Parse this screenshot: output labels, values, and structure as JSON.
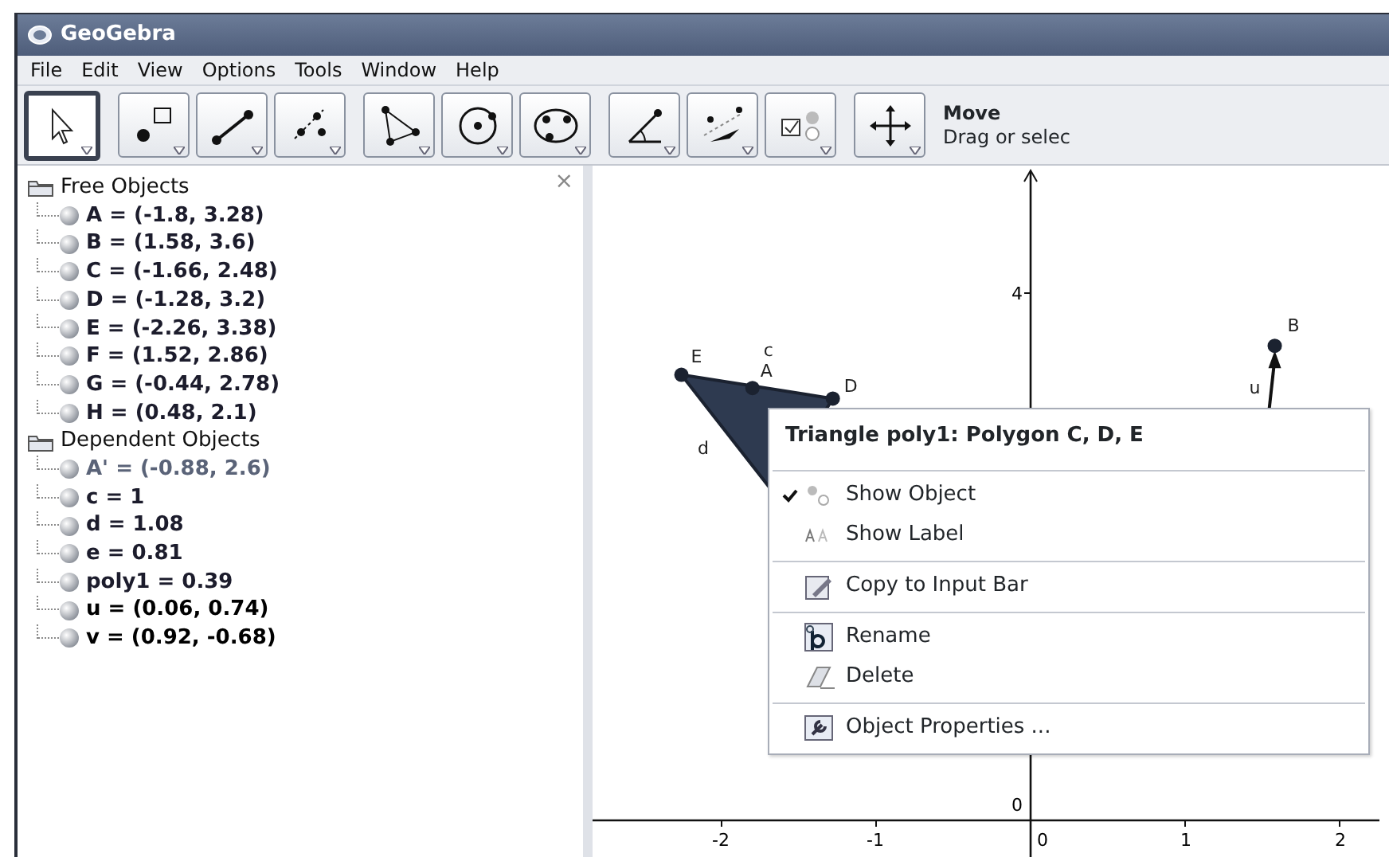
{
  "window": {
    "title": "GeoGebra"
  },
  "menu_bar": [
    "File",
    "Edit",
    "View",
    "Options",
    "Tools",
    "Window",
    "Help"
  ],
  "toolbar": {
    "tool_groups": [
      [
        {
          "kind": "move",
          "selected": true
        }
      ],
      [
        {
          "kind": "point",
          "selected": false
        },
        {
          "kind": "segment",
          "selected": false
        },
        {
          "kind": "perpendicular",
          "selected": false
        }
      ],
      [
        {
          "kind": "polygon",
          "selected": false
        },
        {
          "kind": "circle",
          "selected": false
        },
        {
          "kind": "conic",
          "selected": false
        }
      ],
      [
        {
          "kind": "angle",
          "selected": false
        },
        {
          "kind": "reflect",
          "selected": false
        },
        {
          "kind": "checkbox",
          "selected": false
        }
      ],
      [
        {
          "kind": "move_view",
          "selected": false
        }
      ]
    ],
    "tool_name": "Move",
    "tool_help": "Drag or selec"
  },
  "algebra_view": {
    "close": "×",
    "folders": [
      {
        "label": "Free Objects",
        "children": [
          {
            "text": "A = (-1.8, 3.28)",
            "color": "#1c1c2c"
          },
          {
            "text": "B = (1.58, 3.6)",
            "color": "#1c1c2c"
          },
          {
            "text": "C = (-1.66, 2.48)",
            "color": "#1c1c2c"
          },
          {
            "text": "D = (-1.28, 3.2)",
            "color": "#1c1c2c"
          },
          {
            "text": "E = (-2.26, 3.38)",
            "color": "#1c1c2c"
          },
          {
            "text": "F = (1.52, 2.86)",
            "color": "#1c1c2c"
          },
          {
            "text": "G = (-0.44, 2.78)",
            "color": "#1c1c2c"
          },
          {
            "text": "H = (0.48, 2.1)",
            "color": "#1c1c2c"
          }
        ]
      },
      {
        "label": "Dependent Objects",
        "children": [
          {
            "text": "A' = (-0.88, 2.6)",
            "color": "#5a6378"
          },
          {
            "text": "c = 1",
            "color": "#1c1c2c"
          },
          {
            "text": "d = 1.08",
            "color": "#1c1c2c"
          },
          {
            "text": "e = 0.81",
            "color": "#1c1c2c"
          },
          {
            "text": "poly1 = 0.39",
            "color": "#1c1c2c"
          },
          {
            "text": "u = (0.06, 0.74)",
            "color": "#000000"
          },
          {
            "text": "v = (0.92, -0.68)",
            "color": "#000000"
          }
        ]
      }
    ]
  },
  "graphics_view": {
    "xticks": [
      "-2",
      "-1",
      "0",
      "1",
      "2"
    ],
    "yticks": [
      "4",
      "0"
    ],
    "labels": [
      "E",
      "c",
      "A",
      "D",
      "d",
      "B",
      "u"
    ]
  },
  "context_menu": {
    "title": "Triangle poly1: Polygon C, D, E",
    "groups": [
      [
        {
          "kind": "show_object",
          "label": "Show Object",
          "checked": true
        },
        {
          "kind": "show_label",
          "label": "Show Label",
          "checked": false
        }
      ],
      [
        {
          "kind": "copy",
          "label": "Copy to Input Bar"
        }
      ],
      [
        {
          "kind": "rename",
          "label": "Rename"
        },
        {
          "kind": "delete",
          "label": "Delete"
        }
      ],
      [
        {
          "kind": "properties",
          "label": "Object Properties ..."
        }
      ]
    ]
  }
}
